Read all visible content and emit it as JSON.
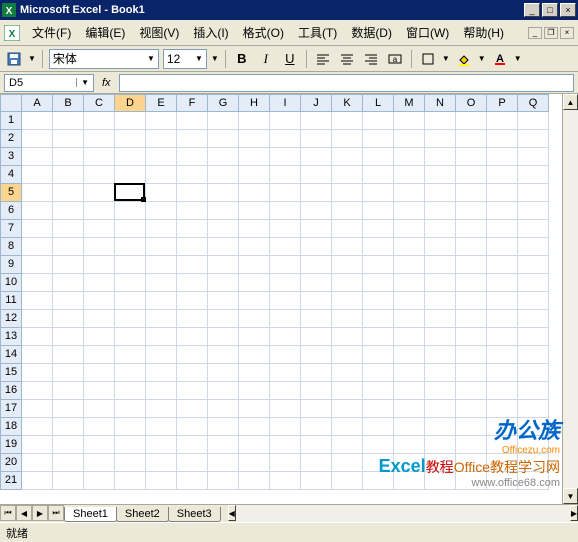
{
  "window": {
    "title": "Microsoft Excel - Book1"
  },
  "menu": {
    "file": "文件(F)",
    "edit": "编辑(E)",
    "view": "视图(V)",
    "insert": "插入(I)",
    "format": "格式(O)",
    "tools": "工具(T)",
    "data": "数据(D)",
    "window": "窗口(W)",
    "help": "帮助(H)"
  },
  "toolbar": {
    "font": "宋体",
    "size": "12",
    "bold": "B",
    "italic": "I",
    "underline": "U"
  },
  "namebox": {
    "value": "D5",
    "fx": "fx"
  },
  "columns": [
    "A",
    "B",
    "C",
    "D",
    "E",
    "F",
    "G",
    "H",
    "I",
    "J",
    "K",
    "L",
    "M",
    "N",
    "O",
    "P",
    "Q"
  ],
  "rows": [
    "1",
    "2",
    "3",
    "4",
    "5",
    "6",
    "7",
    "8",
    "9",
    "10",
    "11",
    "12",
    "13",
    "14",
    "15",
    "16",
    "17",
    "18",
    "19",
    "20",
    "21"
  ],
  "active": {
    "col": 3,
    "row": 4
  },
  "sheets": {
    "s1": "Sheet1",
    "s2": "Sheet2",
    "s3": "Sheet3"
  },
  "status": {
    "ready": "就绪"
  },
  "watermark": {
    "brand1": "办公族",
    "url1": "Officezu.com",
    "brand2a": "Excel",
    "brand2b": "教程",
    "brand3": "Office教程学习网",
    "url3": "www.office68.com"
  }
}
